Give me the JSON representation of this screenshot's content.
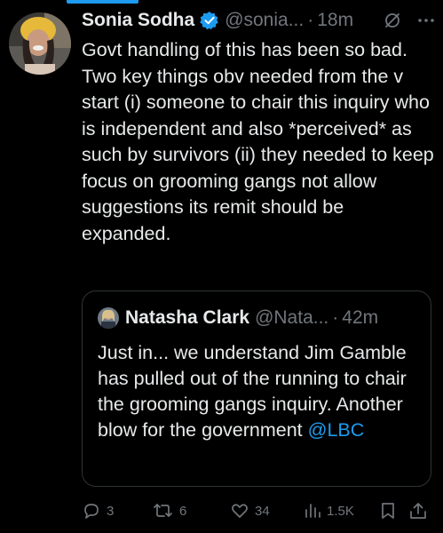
{
  "tweet": {
    "author_name": "Sonia Sodha",
    "handle": "@sonia...",
    "separator": "·",
    "time": "18m",
    "text": "Govt handling of this has been so bad. Two key things obv needed from the v start (i) someone to chair this inquiry who is independent and also *perceived* as such by survivors (ii) they needed to keep focus on grooming gangs not allow suggestions its remit should be expanded."
  },
  "quote": {
    "author_name": "Natasha Clark",
    "handle": "@Nata...",
    "separator": "·",
    "time": "42m",
    "text": "Just in... we understand Jim Gamble has pulled out of the running to chair the grooming gangs inquiry. Another blow for the government ",
    "mention": "@LBC"
  },
  "actions": {
    "replies": "3",
    "reposts": "6",
    "likes": "34",
    "views": "1.5K"
  },
  "icons": {
    "verified": "verified-badge-icon",
    "grok": "grok-icon",
    "more": "more-icon",
    "reply": "reply-icon",
    "repost": "repost-icon",
    "like": "heart-icon",
    "views": "views-icon",
    "bookmark": "bookmark-icon",
    "share": "share-icon"
  },
  "colors": {
    "background": "#000000",
    "text": "#e7e9ea",
    "muted": "#71767b",
    "accent": "#1d9bf0",
    "border": "#2f3336"
  }
}
